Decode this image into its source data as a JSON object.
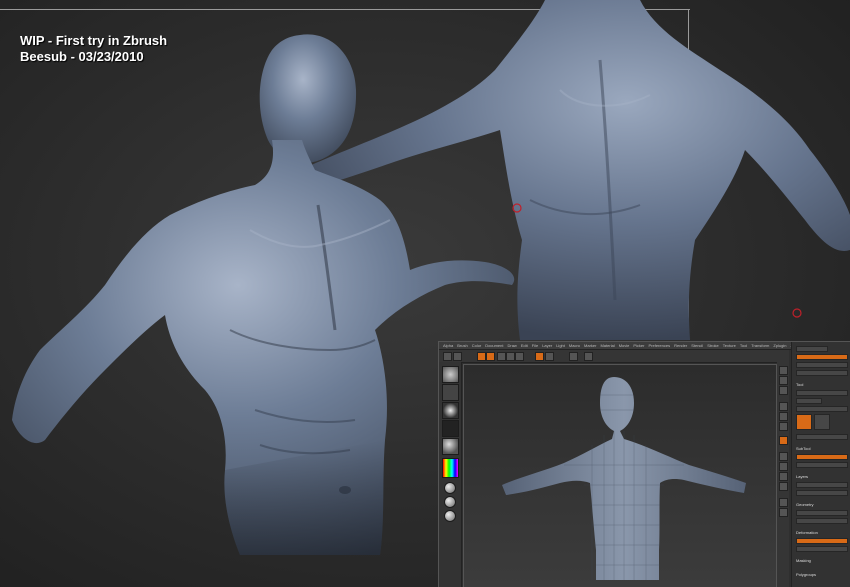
{
  "caption": {
    "line1": "WIP - First try in Zbrush",
    "line2": "Beesub - 03/23/2010"
  },
  "colors": {
    "background": "#2a2a2a",
    "clay": "#6d7d96",
    "clay_dark": "#3c4657",
    "clay_light": "#a8b4c8",
    "zbrush_accent": "#d86a17",
    "marker": "#c0202a"
  },
  "zbrush_ui": {
    "menus": [
      "Alpha",
      "Brush",
      "Color",
      "Document",
      "Draw",
      "Edit",
      "File",
      "Layer",
      "Light",
      "Macro",
      "Marker",
      "Material",
      "Movie",
      "Picker",
      "Preferences",
      "Render",
      "Stencil",
      "Stroke",
      "Texture",
      "Tool",
      "Transform",
      "Zplugin",
      "Zscript"
    ],
    "panels": [
      "Tool",
      "SubTool",
      "Layers",
      "Geometry",
      "Deformation",
      "Masking",
      "Polygroups"
    ]
  }
}
